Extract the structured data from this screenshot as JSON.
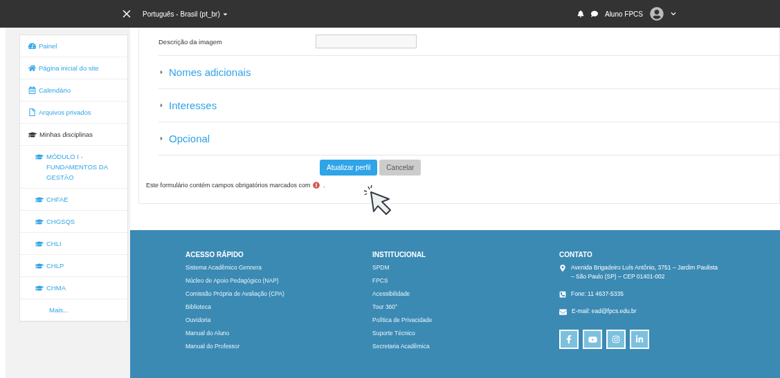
{
  "navbar": {
    "language": "Português - Brasil (pt_br)",
    "user": "Aluno FPCS"
  },
  "sidebar": {
    "items": [
      {
        "kind": "dashboard",
        "label": "Painel"
      },
      {
        "kind": "home",
        "label": "Página inicial do site"
      },
      {
        "kind": "calendar",
        "label": "Calendário"
      },
      {
        "kind": "file",
        "label": "Arquivos privados"
      },
      {
        "kind": "section",
        "label": "Minhas disciplinas"
      },
      {
        "kind": "course",
        "label": "MÓDULO I - FUNDAMENTOS DA GESTÃO"
      },
      {
        "kind": "course",
        "label": "CHFAE"
      },
      {
        "kind": "course",
        "label": "CHGSQS"
      },
      {
        "kind": "course",
        "label": "CHLI"
      },
      {
        "kind": "course",
        "label": "CHLP"
      },
      {
        "kind": "course",
        "label": "CHMA"
      },
      {
        "kind": "more",
        "label": "Mais..."
      }
    ]
  },
  "form": {
    "field": {
      "label": "Descrição da imagem"
    },
    "sections": [
      {
        "title": "Nomes adicionais",
        "expanded": false
      },
      {
        "title": "Interesses",
        "expanded": false
      },
      {
        "title": "Opcional",
        "expanded": false
      }
    ],
    "buttons": [
      {
        "kind": "primary",
        "label": "Atualizar perfil"
      },
      {
        "kind": "secondary",
        "label": "Cancelar"
      }
    ],
    "required_note": "Este formulário contém campos obrigatórios marcados com",
    "required_note_end": "."
  },
  "footer": {
    "columns": [
      {
        "title": "ACESSO RÁPIDO",
        "links": [
          "Sistema Acadêmico Gennera",
          "Núcleo de Apoio Pedagógico (NAP)",
          "Comissão Própria de Avaliação (CPA)",
          "Biblioteca",
          "Ouvidoria",
          "Manual do Aluno",
          "Manual do Professor"
        ]
      },
      {
        "title": "INSTITUCIONAL",
        "links": [
          "SPDM",
          "FPCS",
          "Acessibilidade",
          "Tour 360°",
          "Política de Privacidade",
          "Suporte Técnico",
          "Secretaria Acadêmica"
        ]
      }
    ],
    "contact": {
      "title": "CONTATO",
      "items": [
        {
          "kind": "address",
          "text": "Avenida Brigadeiro Luís Antônio, 3751 – Jardim Paulista – São Paulo (SP) – CEP 01401-002"
        },
        {
          "kind": "phone",
          "text": "Fone: 11 4637-5335"
        },
        {
          "kind": "email",
          "text": "E-mail: ead@fpcs.edu.br"
        }
      ]
    }
  }
}
